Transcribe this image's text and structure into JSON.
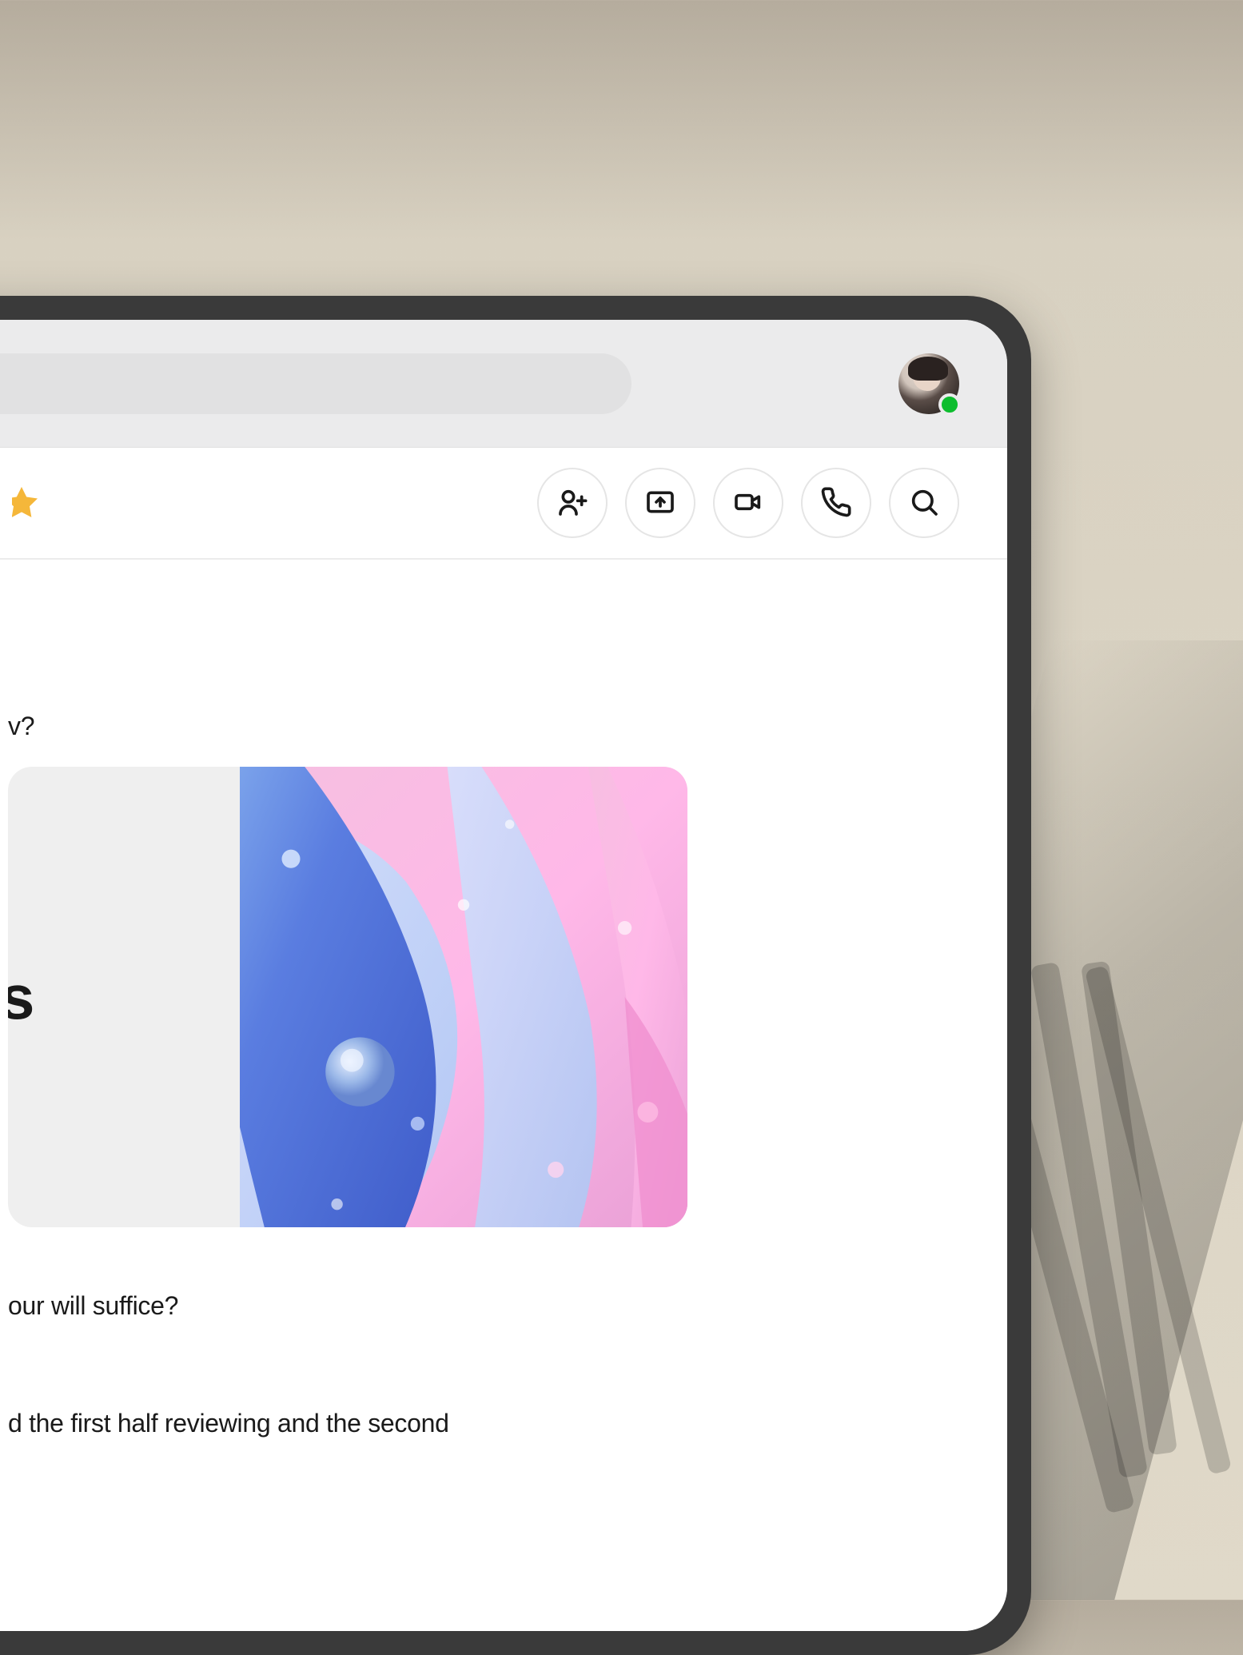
{
  "header": {
    "presence_status": "online"
  },
  "toolbar": {
    "buttons": [
      {
        "name": "add-person",
        "label": "Add people"
      },
      {
        "name": "screen-share",
        "label": "Share screen"
      },
      {
        "name": "video-call",
        "label": "Video call"
      },
      {
        "name": "audio-call",
        "label": "Audio call"
      },
      {
        "name": "search",
        "label": "Search"
      }
    ],
    "starred": true
  },
  "messages": {
    "line1_fragment": "v?",
    "attachment_title_fragment": "s",
    "line2_fragment": "our will suffice?",
    "line3_fragment": "d the first half reviewing and the second"
  },
  "colors": {
    "presence": "#0DBD2E",
    "star": "#F5B73A",
    "topbar_bg": "#ebebec",
    "search_bg": "#e1e1e2",
    "border": "#e5e5e5"
  }
}
